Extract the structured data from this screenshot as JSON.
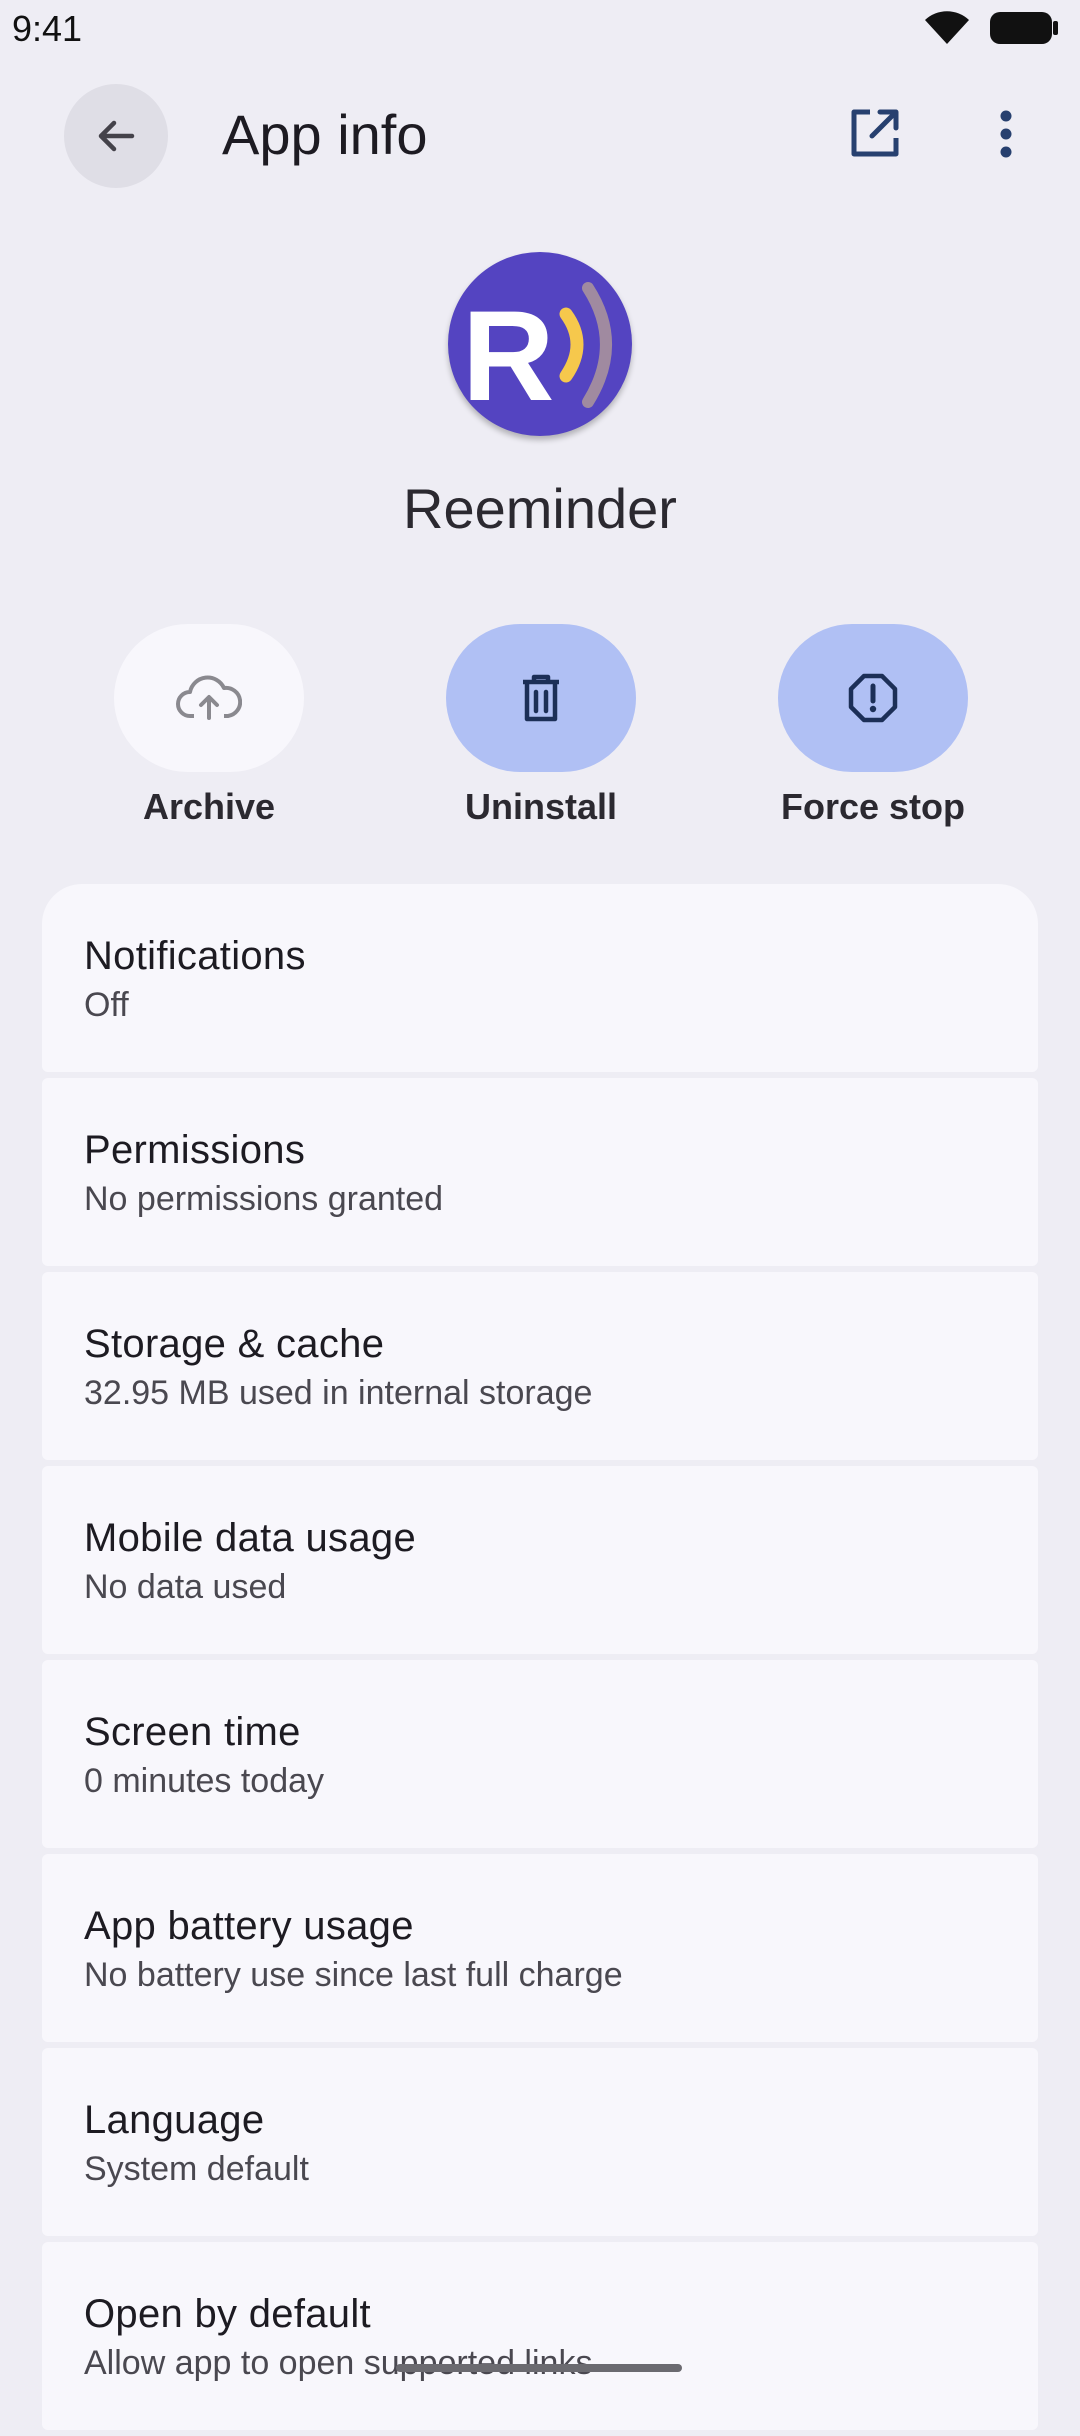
{
  "status": {
    "time": "9:41"
  },
  "header": {
    "title": "App info",
    "back_icon": "arrow-back-icon",
    "open_icon": "open-in-new-icon",
    "more_icon": "more-vert-icon"
  },
  "app": {
    "name": "Reeminder",
    "icon_letter": "R"
  },
  "actions": [
    {
      "label": "Archive",
      "icon": "cloud-upload-icon",
      "bg": "#f8f7fc"
    },
    {
      "label": "Uninstall",
      "icon": "trash-icon",
      "bg": "#b0c0f4"
    },
    {
      "label": "Force stop",
      "icon": "alert-octagon-icon",
      "bg": "#b0c0f4"
    }
  ],
  "settings": [
    {
      "title": "Notifications",
      "subtitle": "Off"
    },
    {
      "title": "Permissions",
      "subtitle": "No permissions granted"
    },
    {
      "title": "Storage & cache",
      "subtitle": "32.95 MB used in internal storage"
    },
    {
      "title": "Mobile data usage",
      "subtitle": "No data used"
    },
    {
      "title": "Screen time",
      "subtitle": "0 minutes today"
    },
    {
      "title": "App battery usage",
      "subtitle": "No battery use since last full charge"
    },
    {
      "title": "Language",
      "subtitle": "System default"
    },
    {
      "title": "Open by default",
      "subtitle": "Allow app to open supported links"
    }
  ],
  "colors": {
    "background": "#eeedf4",
    "card": "#f8f7fc",
    "accent_pill": "#b0c0f4",
    "app_icon": "#5444c1"
  }
}
